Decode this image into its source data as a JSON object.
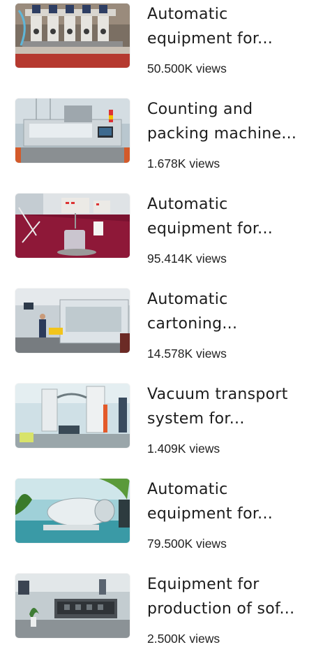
{
  "videos": [
    {
      "title_lines": [
        "Automatic",
        "equipment for..."
      ],
      "views": "50.500K views",
      "thumbnail": "filling-heads-machine-image"
    },
    {
      "title_lines": [
        "Counting and",
        "packing machine..."
      ],
      "views": "1.678K views",
      "thumbnail": "counting-packing-machine-image"
    },
    {
      "title_lines": [
        "Automatic",
        "equipment for..."
      ],
      "views": "95.414K views",
      "thumbnail": "lab-dissolution-tester-image"
    },
    {
      "title_lines": [
        "Automatic",
        "cartoning..."
      ],
      "views": "14.578K views",
      "thumbnail": "cartoning-machine-hall-image"
    },
    {
      "title_lines": [
        "Vacuum transport",
        "system for..."
      ],
      "views": "1.409K views",
      "thumbnail": "vacuum-transport-system-image"
    },
    {
      "title_lines": [
        "Automatic",
        "equipment for..."
      ],
      "views": "79.500K views",
      "thumbnail": "stainless-pump-unit-image"
    },
    {
      "title_lines": [
        "Equipment for",
        "production of sof..."
      ],
      "views": "2.500K views",
      "thumbnail": "production-line-exhibit-image"
    }
  ]
}
